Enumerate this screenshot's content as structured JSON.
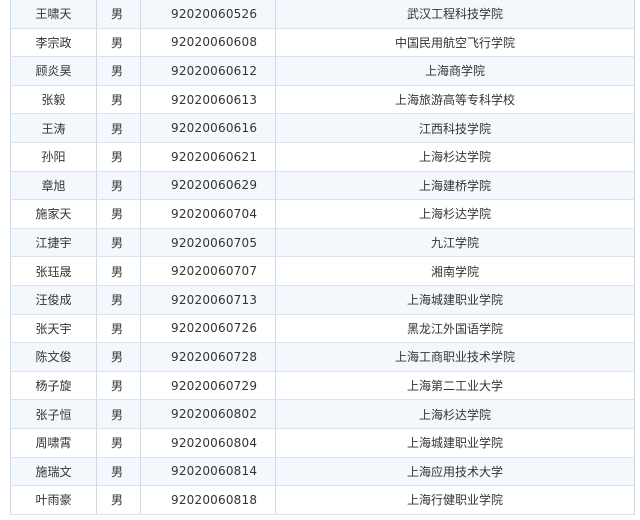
{
  "table": {
    "rows": [
      {
        "name": "王啸天",
        "gender": "男",
        "id": "92020060526",
        "school": "武汉工程科技学院"
      },
      {
        "name": "李宗政",
        "gender": "男",
        "id": "92020060608",
        "school": "中国民用航空飞行学院"
      },
      {
        "name": "顾炎昊",
        "gender": "男",
        "id": "92020060612",
        "school": "上海商学院"
      },
      {
        "name": "张毅",
        "gender": "男",
        "id": "92020060613",
        "school": "上海旅游高等专科学校"
      },
      {
        "name": "王涛",
        "gender": "男",
        "id": "92020060616",
        "school": "江西科技学院"
      },
      {
        "name": "孙阳",
        "gender": "男",
        "id": "92020060621",
        "school": "上海杉达学院"
      },
      {
        "name": "章旭",
        "gender": "男",
        "id": "92020060629",
        "school": "上海建桥学院"
      },
      {
        "name": "施家天",
        "gender": "男",
        "id": "92020060704",
        "school": "上海杉达学院"
      },
      {
        "name": "江捷宇",
        "gender": "男",
        "id": "92020060705",
        "school": "九江学院"
      },
      {
        "name": "张珏晟",
        "gender": "男",
        "id": "92020060707",
        "school": "湘南学院"
      },
      {
        "name": "汪俊成",
        "gender": "男",
        "id": "92020060713",
        "school": "上海城建职业学院"
      },
      {
        "name": "张天宇",
        "gender": "男",
        "id": "92020060726",
        "school": "黑龙江外国语学院"
      },
      {
        "name": "陈文俊",
        "gender": "男",
        "id": "92020060728",
        "school": "上海工商职业技术学院"
      },
      {
        "name": "杨子旋",
        "gender": "男",
        "id": "92020060729",
        "school": "上海第二工业大学"
      },
      {
        "name": "张子恒",
        "gender": "男",
        "id": "92020060802",
        "school": "上海杉达学院"
      },
      {
        "name": "周啸霄",
        "gender": "男",
        "id": "92020060804",
        "school": "上海城建职业学院"
      },
      {
        "name": "施瑞文",
        "gender": "男",
        "id": "92020060814",
        "school": "上海应用技术大学"
      },
      {
        "name": "叶雨豪",
        "gender": "男",
        "id": "92020060818",
        "school": "上海行健职业学院"
      }
    ]
  }
}
